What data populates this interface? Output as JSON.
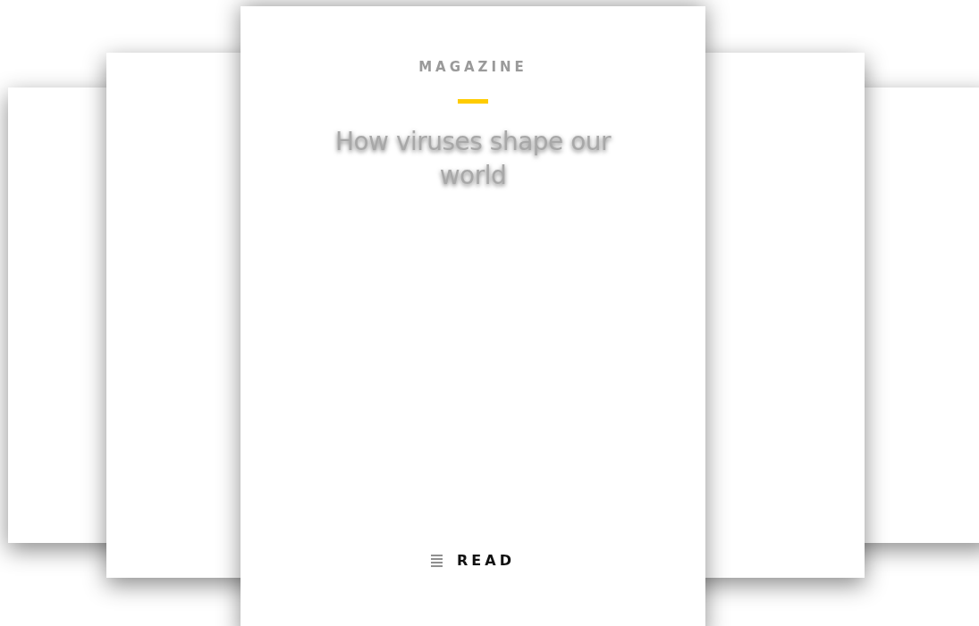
{
  "card": {
    "eyebrow": "MAGAZINE",
    "title": "How viruses shape our world",
    "action": "READ"
  }
}
